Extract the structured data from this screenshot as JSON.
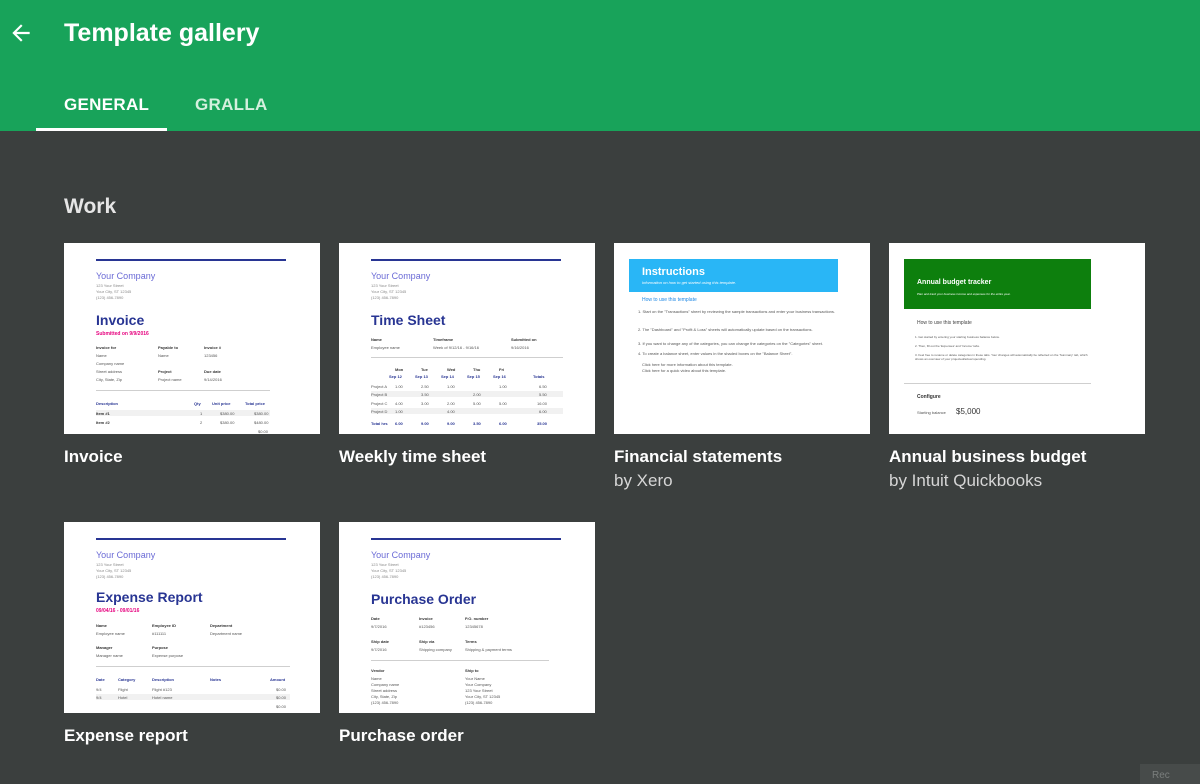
{
  "header": {
    "title": "Template gallery",
    "tabs": [
      "GENERAL",
      "GRALLA"
    ],
    "active_tab": "GENERAL",
    "color": "#18a35a"
  },
  "section": {
    "title": "Work"
  },
  "cards": [
    {
      "name": "Invoice",
      "company": "Your Company",
      "address": [
        "123 Your Street",
        "Your City, ST 12345",
        "(123) 456-7890"
      ],
      "doc_title": "Invoice",
      "subtitle": "Submitted on 9/9/2016",
      "fields": [
        "Invoice for",
        "Payable to",
        "Invoice #",
        "Name",
        "Name",
        "123456",
        "Company name",
        "Project",
        "Due date",
        "Street address",
        "Project name",
        "9/14/2016",
        "City, State, Zip"
      ],
      "table_headers": [
        "Description",
        "Qty",
        "Unit price",
        "Total price"
      ],
      "rows": [
        [
          "Item #1",
          "1",
          "$380.00",
          "$380.00"
        ],
        [
          "Item #2",
          "2",
          "$380.00",
          "$480.00"
        ]
      ],
      "total": "$0.00"
    },
    {
      "name": "Weekly time sheet",
      "company": "Your Company",
      "address": [
        "123 Your Street",
        "Your City, ST 12345",
        "(123) 456-7890"
      ],
      "doc_title": "Time Sheet",
      "fields": [
        "Name",
        "Timeframe",
        "Submitted on",
        "Employee name",
        "Week of 9/12/16 - 9/16/16",
        "9/16/2016"
      ],
      "days": [
        "Mon",
        "Tue",
        "Wed",
        "Thu",
        "Fri"
      ],
      "dates": [
        "Sep 12",
        "Sep 13",
        "Sep 14",
        "Sep 15",
        "Sep 16",
        "Totals"
      ],
      "rows": [
        [
          "Project A",
          "1.00",
          "2.50",
          "1.00",
          "",
          "1.00",
          "6.50"
        ],
        [
          "Project B",
          "",
          "3.50",
          "",
          "2.00",
          "",
          "5.50"
        ],
        [
          "Project C",
          "4.00",
          "3.00",
          "2.00",
          "5.00",
          "5.00",
          "16.00"
        ],
        [
          "Project D",
          "1.00",
          "",
          "4.00",
          "",
          "",
          "6.00"
        ]
      ],
      "total_row": [
        "Total hrs",
        "6.00",
        "9.00",
        "9.00",
        "3.50",
        "6.00",
        "35.00"
      ]
    },
    {
      "name": "Financial statements",
      "by": "by Xero",
      "banner_title": "Instructions",
      "banner_sub": "Information on how to get started using this template.",
      "banner_color": "#29b6f6",
      "link": "How to use this template",
      "steps": [
        "1. Start on the \"Transactions\" sheet by reviewing the sample transactions and enter your business transactions.",
        "2. The \"Dashboard\" and \"Profit & Loss\" sheets will automatically update based on the transactions.",
        "3. If you want to change any of the categories, you can change the categories on the \"Categories\" sheet.",
        "4. To create a balance sheet, enter values in the shaded boxes on the \"Balance Sheet\".",
        "Click here for more information about this template.",
        "Click here for a quick video about this template."
      ]
    },
    {
      "name": "Annual business budget",
      "by": "by Intuit Quickbooks",
      "banner_title": "Annual budget tracker",
      "banner_sub": "Plan and track your business income and expenses for the entire year.",
      "banner_color": "#0d7f0d",
      "how_title": "How to use this template",
      "steps": [
        "1. Get started by entering your starting business balance below.",
        "2. Then, fill out the 'Expenses' and 'Income' tabs.",
        "3. Feel free to rename or delete categories in these tabs. Your changes will automatically be reflected on the 'Summary' tab, which shows an overview of your projected/actual spending."
      ],
      "configure": "Configure",
      "starting_label": "Starting balance",
      "starting_value": "$5,000"
    },
    {
      "name": "Expense report",
      "company": "Your Company",
      "address": [
        "123 Your Street",
        "Your City, ST 12345",
        "(123) 456-7890"
      ],
      "doc_title": "Expense Report",
      "subtitle": "09/04/16 - 09/01/16",
      "fields": [
        "Name",
        "Employee ID",
        "Department",
        "Employee name",
        "#111111",
        "Department name",
        "Manager",
        "Purpose",
        "Manager name",
        "Expense purpose"
      ],
      "table_headers": [
        "Date",
        "Category",
        "Description",
        "Notes",
        "Amount"
      ],
      "rows": [
        [
          "9/4",
          "Flight",
          "Flight #123",
          "",
          "$0.00"
        ],
        [
          "9/4",
          "Hotel",
          "Hotel name",
          "",
          "$0.00"
        ]
      ],
      "total": "$0.00"
    },
    {
      "name": "Purchase order",
      "company": "Your Company",
      "address": [
        "123 Your Street",
        "Your City, ST 12345",
        "(123) 456-7890"
      ],
      "doc_title": "Purchase Order",
      "fields": [
        "Date",
        "Invoice",
        "P.O. number",
        "9/7/2016",
        "#123456",
        "12345678",
        "Ship date",
        "Ship via",
        "Terms",
        "9/7/2016",
        "Shipping company",
        "Shipping & payment terms"
      ],
      "vendor": [
        "Vendor",
        "Name",
        "Company name",
        "Street address",
        "City, State, Zip",
        "(123) 456-7890"
      ],
      "shipto": [
        "Ship to",
        "Your Name",
        "Your Company",
        "123 Your Street",
        "Your City, ST 12345",
        "(123) 456-7890"
      ]
    }
  ],
  "corner_text": "Rec"
}
